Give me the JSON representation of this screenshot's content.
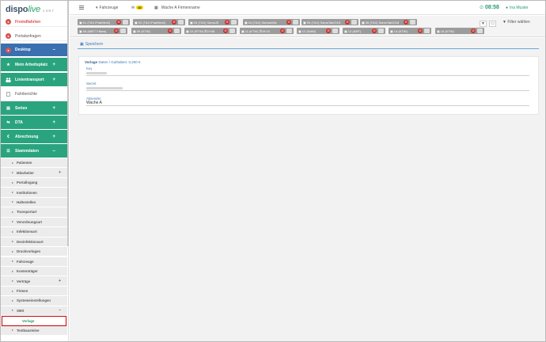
{
  "app": {
    "logo_main": "dispo",
    "logo_italic": "live",
    "version": "v 4.9.7"
  },
  "sidebar": {
    "items": [
      {
        "label": "Fremdfahrten",
        "style": "plain",
        "icon": "badge-icon"
      },
      {
        "label": "Portalanfragen",
        "style": "plain",
        "icon": "badge-icon"
      },
      {
        "label": "Desktop",
        "style": "blue",
        "icon": "badge-icon",
        "toggle": "–"
      },
      {
        "label": "Mein Arbeitsplatz",
        "style": "green",
        "icon": "star-icon",
        "toggle": "+"
      },
      {
        "label": "Linientransport",
        "style": "green",
        "icon": "users-icon",
        "toggle": "+"
      },
      {
        "label": "Fahrberichte",
        "style": "plain",
        "icon": "document-icon"
      },
      {
        "label": "Serien",
        "style": "green",
        "icon": "file-icon",
        "toggle": "+"
      },
      {
        "label": "DTA",
        "style": "green",
        "icon": "transfer-icon",
        "toggle": "+"
      },
      {
        "label": "Abrechnung",
        "style": "green",
        "icon": "euro-icon",
        "toggle": "+"
      },
      {
        "label": "Stammdaten",
        "style": "green",
        "icon": "list-icon",
        "toggle": "–"
      }
    ],
    "subitems": [
      {
        "label": "Patienten"
      },
      {
        "label": "Mitarbeiter",
        "toggle": "+"
      },
      {
        "label": "Portallogang"
      },
      {
        "label": "Institutionen"
      },
      {
        "label": "Haltestellen"
      },
      {
        "label": "Transportart"
      },
      {
        "label": "Verordnungsart"
      },
      {
        "label": "Infektionsart"
      },
      {
        "label": "Desinfektionsart"
      },
      {
        "label": "Druckvorlagen"
      },
      {
        "label": "Fahrzeuge"
      },
      {
        "label": "Kostenträger"
      },
      {
        "label": "Verträge",
        "toggle": "+"
      },
      {
        "label": "Firmen"
      },
      {
        "label": "Systemeinstellungen"
      },
      {
        "label": "SMS",
        "toggle": "–"
      },
      {
        "label": "Vorlage",
        "active": true
      },
      {
        "label": "Textbausteine"
      }
    ]
  },
  "topbar": {
    "menu_icon": "hamburger-icon",
    "vehicles_label": "Fahrzeuge",
    "messages_count": "40",
    "company": "Wache A Firmenname",
    "clock": "08:58",
    "user": "Ina Muster"
  },
  "vehicles": [
    {
      "label": "01 (TAX iPadMini2)"
    },
    {
      "label": "02 (TAX iPadMini4)"
    },
    {
      "label": "03 (TAX) SamsJ5"
    },
    {
      "label": "04 (TAX) SamsA5fw"
    },
    {
      "label": "05 (TAX) SamsTab2016"
    },
    {
      "label": "06 (TAX) SamsTab2018"
    },
    {
      "label": "08 (MIET Filiam)"
    },
    {
      "label": "09 (KTW)"
    },
    {
      "label": "10 (RTW) ⏱19:06"
    },
    {
      "label": "11 (KTW) ⏱19:00"
    },
    {
      "label": "12 (NAW)"
    },
    {
      "label": "13 (NEF)"
    },
    {
      "label": "14 (KTW)"
    },
    {
      "label": "15 (KTW)"
    }
  ],
  "filter": {
    "label": "Filter wählen"
  },
  "actions": {
    "save_label": "Speichern"
  },
  "form": {
    "title_bold": "Vorlage",
    "title_rest": "Daten / Guthaben: 0,200 €",
    "key_label": "Key",
    "secret_label": "Secret",
    "sender_label": "Absender",
    "sender_value": "Wache A"
  },
  "colors": {
    "green": "#2aa47e",
    "blue": "#3a6fb0",
    "accent_link": "#3a78b8",
    "vehicle_chip": "#9c9c9c",
    "alert_red": "#c9302c"
  }
}
